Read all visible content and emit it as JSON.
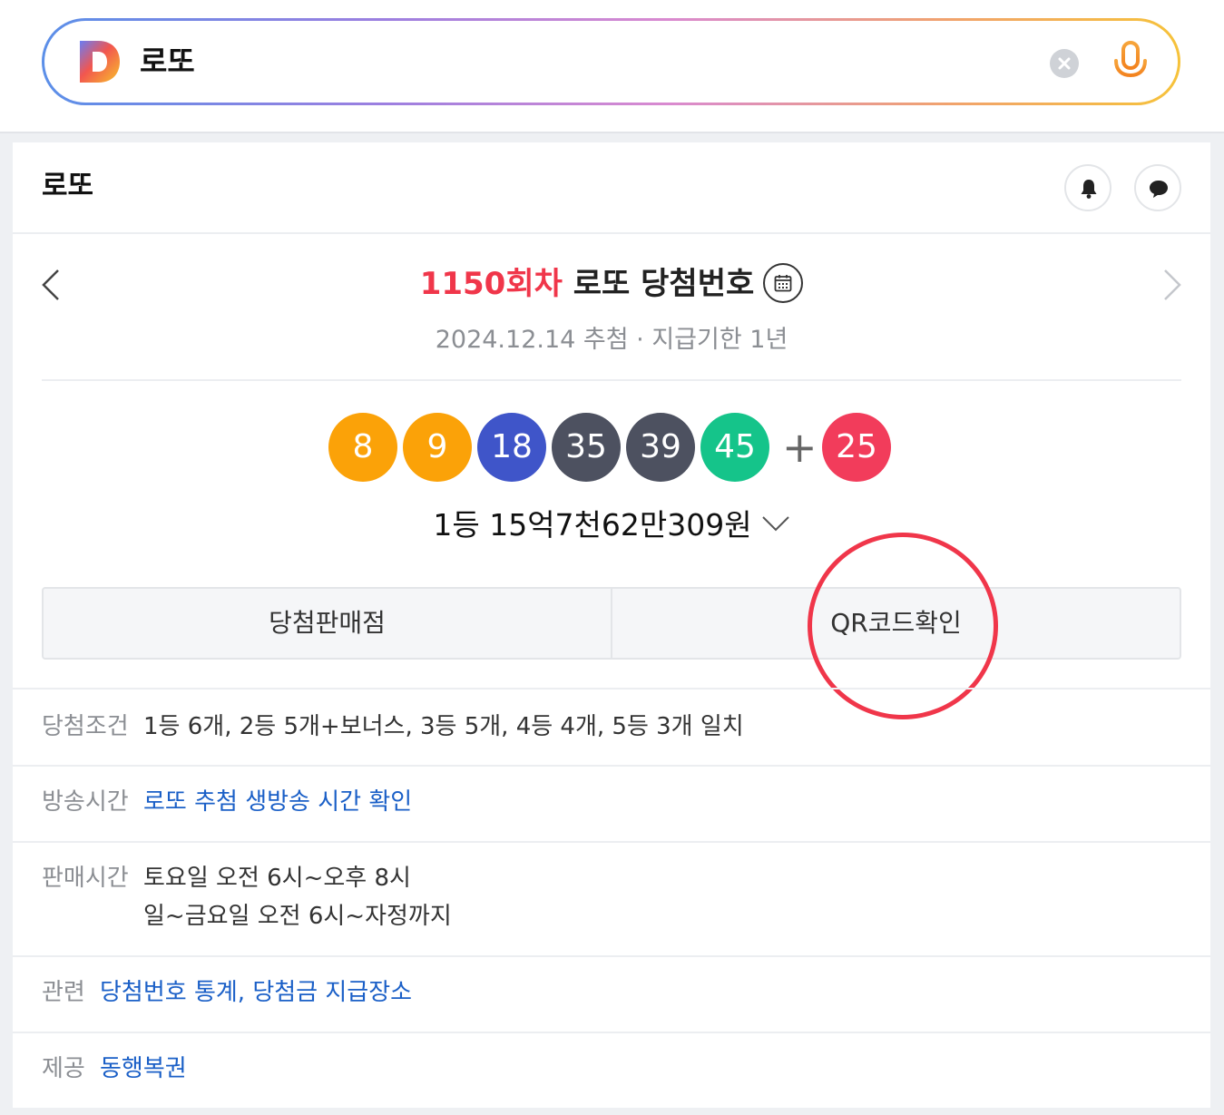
{
  "search": {
    "query": "로또"
  },
  "card": {
    "title": "로또"
  },
  "draw": {
    "round": "1150회차",
    "title_rest": "로또 당첨번호",
    "subtitle": "2024.12.14 추첨 · 지급기한 1년",
    "numbers": [
      "8",
      "9",
      "18",
      "35",
      "39",
      "45"
    ],
    "bonus": "25",
    "plus": "+",
    "prize_text": "1등 15억7천62만309원",
    "ball_colors": [
      "#fba208",
      "#fba208",
      "#3f55c9",
      "#4d5160",
      "#4d5160",
      "#15c48a"
    ],
    "bonus_color": "#f23c5b"
  },
  "buttons": {
    "winning_store": "당첨판매점",
    "qr_check": "QR코드확인"
  },
  "info": {
    "condition_label": "당첨조건",
    "condition_value": "1등 6개, 2등 5개+보너스, 3등 5개, 4등 4개, 5등 3개 일치",
    "broadcast_label": "방송시간",
    "broadcast_value": "로또 추첨 생방송 시간 확인",
    "sales_label": "판매시간",
    "sales_line1": "토요일 오전 6시~오후 8시",
    "sales_line2": "일~금요일 오전 6시~자정까지",
    "related_label": "관련",
    "related_link1": "당첨번호 통계",
    "related_sep": ", ",
    "related_link2": "당첨금 지급장소",
    "provider_label": "제공",
    "provider_value": "동행복권"
  },
  "icons": {
    "logo": "daum-logo",
    "clear": "clear-icon",
    "mic": "microphone-icon",
    "bell": "bell-icon",
    "chat": "chat-bubble-icon",
    "calendar": "calendar-icon",
    "prev": "chevron-left-icon",
    "next": "chevron-right-icon",
    "expand": "chevron-down-icon"
  },
  "colors": {
    "accent_red": "#f0364a",
    "link_blue": "#1a5fc7"
  }
}
